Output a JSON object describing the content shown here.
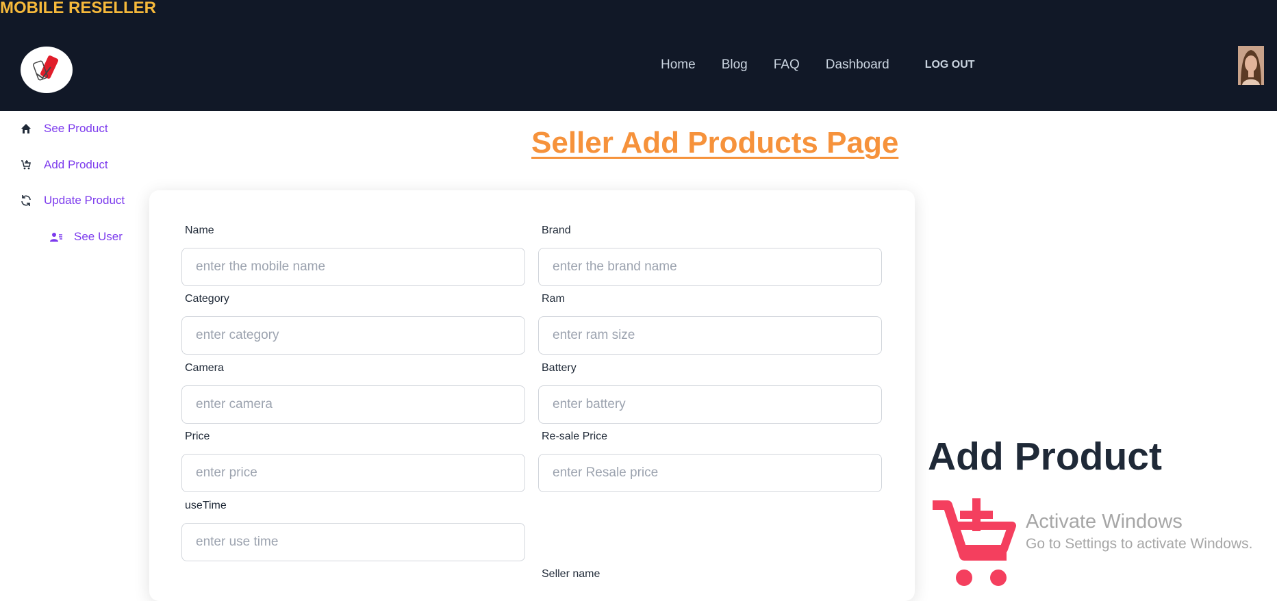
{
  "header": {
    "brand": "MOBILE RESELLER",
    "nav": [
      "Home",
      "Blog",
      "FAQ",
      "Dashboard"
    ],
    "logout": "LOG OUT"
  },
  "sidebar": {
    "items": [
      {
        "label": "See Product",
        "icon": "home-icon"
      },
      {
        "label": "Add Product",
        "icon": "cart-add-icon"
      },
      {
        "label": "Update Product",
        "icon": "refresh-icon"
      },
      {
        "label": "See User",
        "icon": "user-list-icon"
      }
    ]
  },
  "page": {
    "title": "Seller Add Products Page"
  },
  "form": {
    "name": {
      "label": "Name",
      "placeholder": "enter the mobile name"
    },
    "brand": {
      "label": "Brand",
      "placeholder": "enter the brand name"
    },
    "category": {
      "label": "Category",
      "placeholder": "enter category"
    },
    "ram": {
      "label": "Ram",
      "placeholder": "enter ram size"
    },
    "camera": {
      "label": "Camera",
      "placeholder": "enter camera"
    },
    "battery": {
      "label": "Battery",
      "placeholder": "enter battery"
    },
    "price": {
      "label": "Price",
      "placeholder": "enter price"
    },
    "resale": {
      "label": "Re-sale Price",
      "placeholder": "enter Resale price"
    },
    "usetime": {
      "label": "useTime",
      "placeholder": "enter use time"
    },
    "seller": {
      "label": "Seller name"
    }
  },
  "right": {
    "title": "Add Product"
  },
  "watermark": {
    "line1": "Activate Windows",
    "line2": "Go to Settings to activate Windows."
  },
  "colors": {
    "header_bg": "#111827",
    "brand": "#f6b93b",
    "title": "#f6923b",
    "sidebar_text": "#7c3aed",
    "cart": "#f43f5e"
  }
}
